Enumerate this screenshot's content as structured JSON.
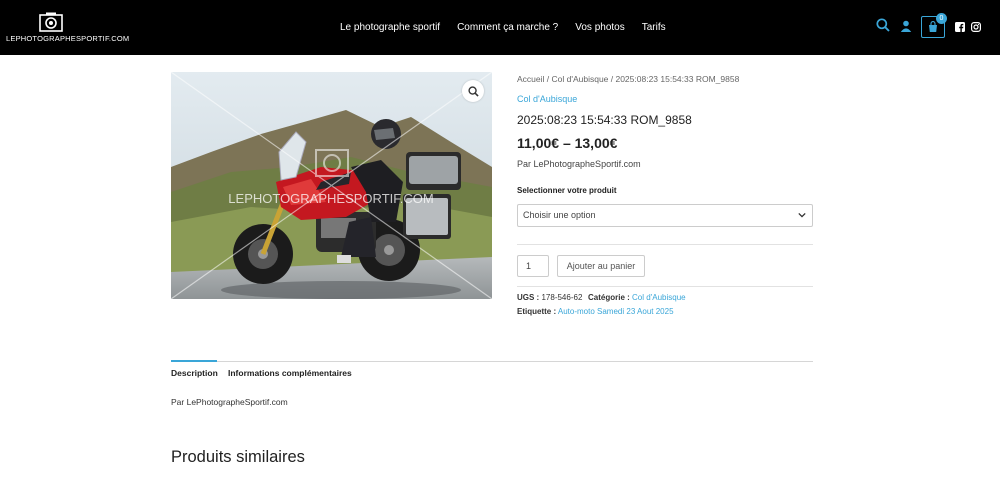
{
  "header": {
    "logo_text": "LEPHOTOGRAPHESPORTIF.COM",
    "nav": [
      "Le photographe sportif",
      "Comment ça marche ?",
      "Vos photos",
      "Tarifs"
    ],
    "cart_count": "0"
  },
  "product": {
    "breadcrumb": "Accueil / Col d'Aubisque / 2025:08:23 15:54:33 ROM_9858",
    "category_link": "Col d'Aubisque",
    "title": "2025:08:23 15:54:33 ROM_9858",
    "price": "11,00€ – 13,00€",
    "byline": "Par LePhotographeSportif.com",
    "select_label": "Selectionner votre produit",
    "select_value": "Choisir une option",
    "quantity": "1",
    "add_to_cart": "Ajouter au panier",
    "sku_label": "UGS :",
    "sku_value": "178-546-62",
    "category_label": "Catégorie :",
    "category_value": "Col d'Aubisque",
    "tag_label": "Etiquette :",
    "tag_value": "Auto-moto Samedi 23 Aout 2025",
    "watermark": "LEPHOTOGRAPHESPORTIF.COM"
  },
  "tabs": [
    "Description",
    "Informations complémentaires"
  ],
  "description_text": "Par LePhotographeSportif.com",
  "similar_title": "Produits similaires",
  "colors": {
    "accent": "#3aa6d8",
    "header_bg": "#000000",
    "bike_red": "#c41820"
  },
  "icons": [
    "camera-logo-icon",
    "search-icon",
    "user-icon",
    "cart-icon",
    "facebook-icon",
    "instagram-icon",
    "zoom-icon",
    "chevron-down-icon"
  ]
}
